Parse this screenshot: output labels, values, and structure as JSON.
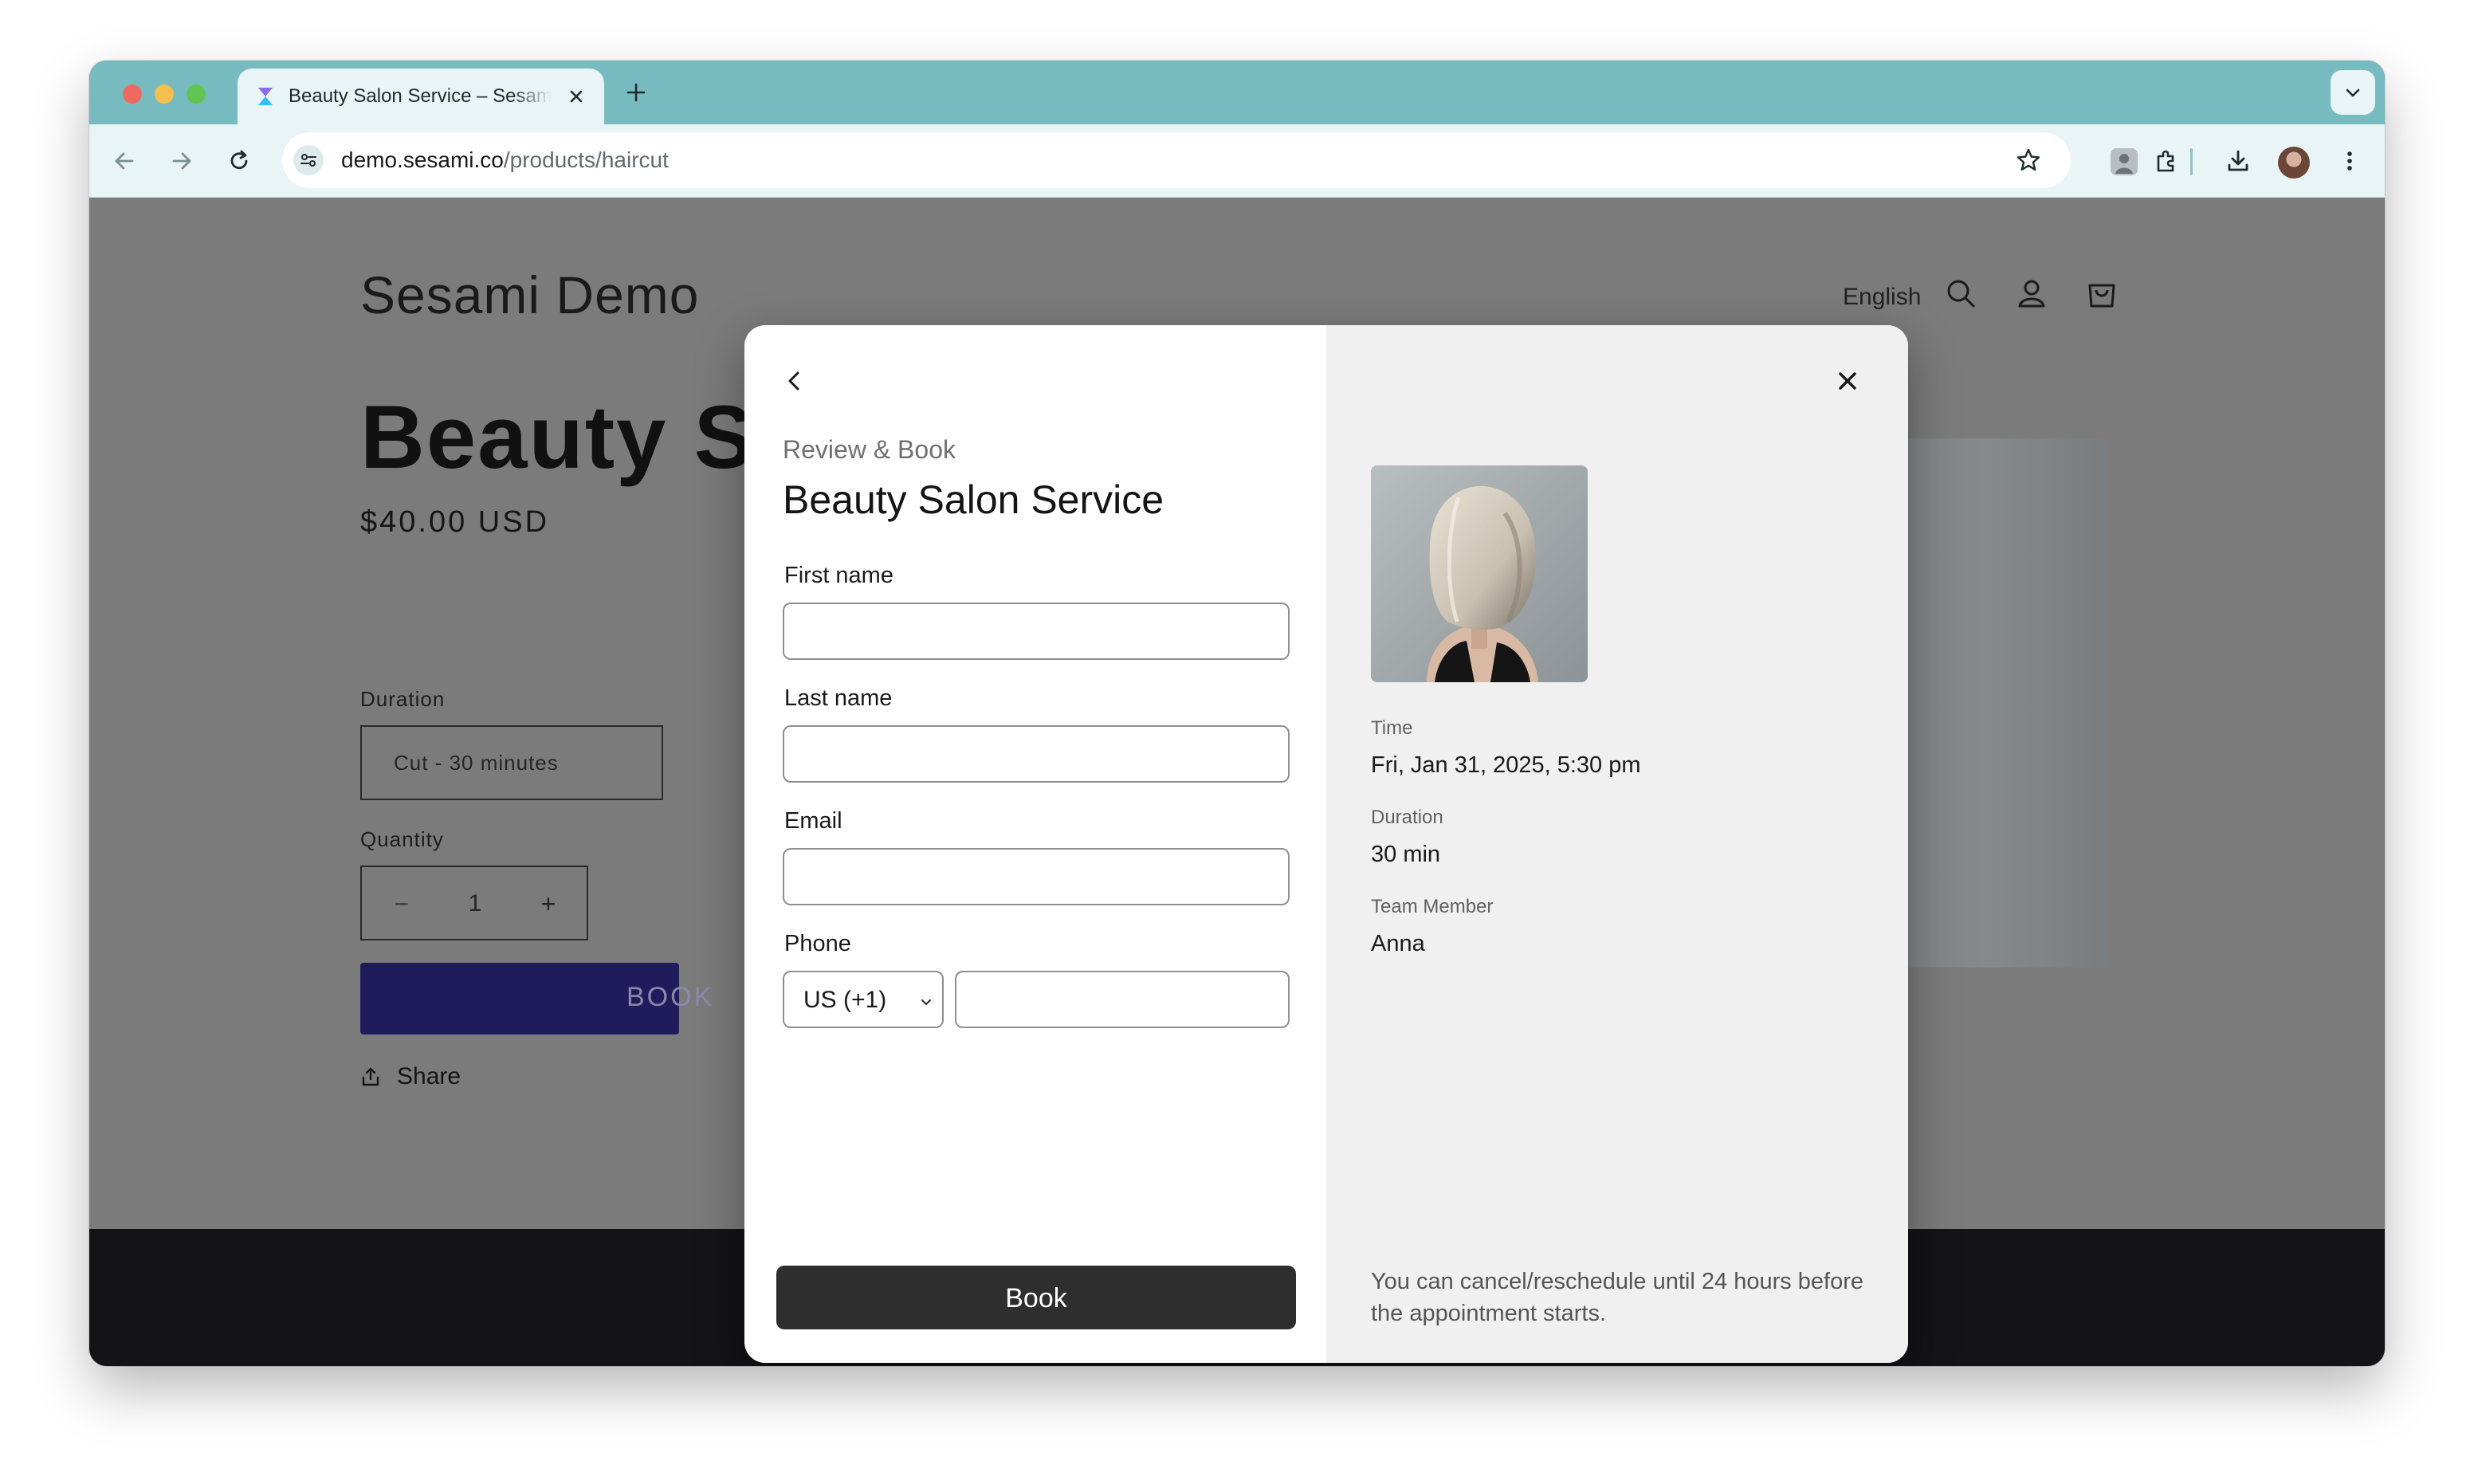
{
  "browser": {
    "tab_title": "Beauty Salon Service – Sesami Demo",
    "url_host": "demo.sesami.co",
    "url_path": "/products/haircut"
  },
  "page": {
    "store_name": "Sesami Demo",
    "product_title": "Beauty Salon Service",
    "price": "$40.00 USD",
    "duration_label": "Duration",
    "duration_value": "Cut - 30 minutes",
    "quantity_label": "Quantity",
    "quantity_value": "1",
    "quantity_minus": "−",
    "quantity_plus": "+",
    "book_button": "BOOK",
    "share_label": "Share",
    "language": "English"
  },
  "modal": {
    "eyebrow": "Review & Book",
    "title": "Beauty Salon Service",
    "form": {
      "first_name_label": "First name",
      "first_name_value": "",
      "last_name_label": "Last name",
      "last_name_value": "",
      "email_label": "Email",
      "email_value": "",
      "phone_label": "Phone",
      "phone_country": "US (+1)",
      "phone_value": ""
    },
    "book_button": "Book",
    "details": {
      "time_label": "Time",
      "time_value": "Fri, Jan 31, 2025, 5:30 pm",
      "duration_label": "Duration",
      "duration_value": "30 min",
      "team_label": "Team Member",
      "team_value": "Anna"
    },
    "policy": "You can cancel/reschedule until 24 hours before the appointment starts."
  },
  "icons": {
    "back": "chevron-left-icon",
    "close": "close-icon",
    "search": "search-icon",
    "account": "account-icon",
    "cart": "cart-icon",
    "share": "share-icon"
  },
  "colors": {
    "tabstrip": "#77babf",
    "toolbar": "#e8f4f5",
    "book_button": "#2e2e2e",
    "page_book_button": "#201c5c",
    "footer": "#131318"
  }
}
